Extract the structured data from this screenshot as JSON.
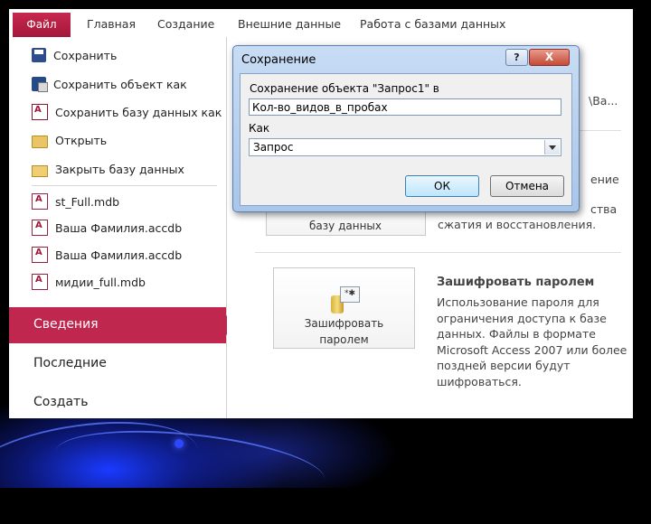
{
  "ribbon": {
    "file_tab": "Файл",
    "tabs": [
      "Главная",
      "Создание",
      "Внешние данные",
      "Работа с базами данных"
    ]
  },
  "file_menu": {
    "commands": [
      {
        "label": "Сохранить",
        "icon": "save-icon"
      },
      {
        "label": "Сохранить объект как",
        "icon": "save-object-icon"
      },
      {
        "label": "Сохранить базу данных как",
        "icon": "save-database-icon"
      },
      {
        "label": "Открыть",
        "icon": "open-folder-icon"
      },
      {
        "label": "Закрыть базу данных",
        "icon": "close-folder-icon"
      }
    ],
    "recent_files": [
      "st_Full.mdb",
      "Ваша Фамилия.accdb",
      "Ваша Фамилия.accdb",
      "мидии_full.mdb"
    ],
    "nav": [
      {
        "label": "Сведения",
        "selected": true
      },
      {
        "label": "Последние",
        "selected": false
      },
      {
        "label": "Создать",
        "selected": false
      }
    ]
  },
  "info_pane": {
    "partial_text": {
      "top_right": "\\Ва...",
      "compact_line1": "ение",
      "compact_line2": "ства",
      "compact_line3": "сжатия и восстановления.",
      "compact_button_fragment": "базу данных"
    },
    "encrypt": {
      "button_label_line1": "Зашифровать",
      "button_label_line2": "паролем",
      "title": "Зашифровать паролем",
      "description_lines": [
        "Использование пароля для",
        "ограничения доступа к базе",
        "данных. Файлы в формате",
        "Microsoft Access 2007 или более",
        "поздней версии будут",
        "шифроваться."
      ]
    }
  },
  "dialog": {
    "title": "Сохранение",
    "help_glyph": "?",
    "close_glyph": "X",
    "name_label": "Сохранение объекта \"Запрос1\" в",
    "name_value": "Кол-во_видов_в_пробах",
    "type_label": "Как",
    "type_value": "Запрос",
    "ok_label": "ОК",
    "cancel_label": "Отмена"
  },
  "colors": {
    "accent": "#c0274f",
    "dialog_frame": "#a9c5ea",
    "slide_background": "#000000"
  }
}
